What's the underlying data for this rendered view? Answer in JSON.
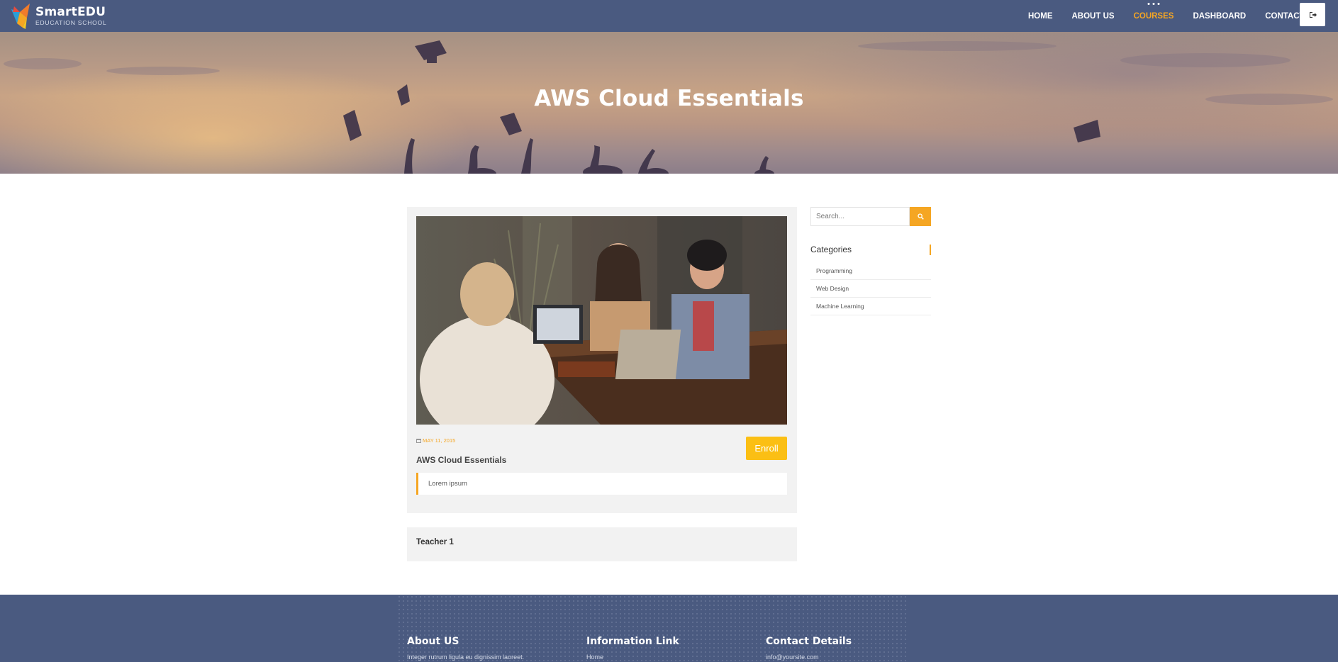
{
  "brand": {
    "name": "SmartEDU",
    "tagline": "EDUCATION SCHOOL",
    "colors": {
      "nav_bg": "#4a5a80",
      "accent": "#f5a623",
      "enroll": "#fbbf14"
    }
  },
  "nav": {
    "items": [
      {
        "label": "HOME",
        "active": false
      },
      {
        "label": "ABOUT US",
        "active": false
      },
      {
        "label": "COURSES",
        "active": true
      },
      {
        "label": "DASHBOARD",
        "active": false
      },
      {
        "label": "CONTACT",
        "active": false
      }
    ],
    "logout_icon": "sign-out-icon"
  },
  "hero": {
    "title": "AWS Cloud Essentials"
  },
  "course": {
    "date": "MAY 11, 2015",
    "date_icon": "calendar-icon",
    "title": "AWS Cloud Essentials",
    "enroll_label": "Enroll",
    "description": "Lorem ipsum",
    "teacher": "Teacher 1"
  },
  "sidebar": {
    "search": {
      "placeholder": "Search...",
      "icon": "search-icon"
    },
    "categories_heading": "Categories",
    "categories": [
      "Programming",
      "Web Design",
      "Machine Learning"
    ]
  },
  "footer": {
    "about": {
      "heading": "About US",
      "text": "Integer rutrum ligula eu dignissim laoreet."
    },
    "links": {
      "heading": "Information Link",
      "first_link": "Home"
    },
    "contact": {
      "heading": "Contact Details",
      "email": "info@yoursite.com"
    }
  }
}
